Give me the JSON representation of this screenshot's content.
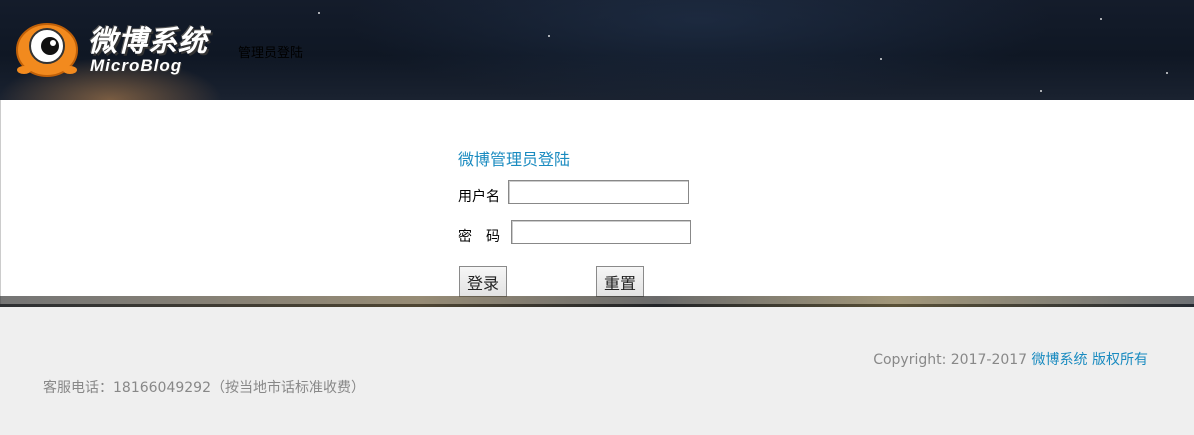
{
  "header": {
    "logo_cn": "微博系统",
    "logo_en": "MicroBlog",
    "title": "管理员登陆"
  },
  "login": {
    "heading": "微博管理员登陆",
    "username_label": "用户名",
    "password_label": "密　码",
    "username_value": "",
    "password_value": "",
    "login_button": "登录",
    "reset_button": "重置"
  },
  "footer": {
    "copyright_prefix": "Copyright: 2017-2017 ",
    "copyright_link": "微博系统 版权所有",
    "hotline": "客服电话：18166049292（按当地市话标准收费）"
  },
  "colors": {
    "link": "#1a8bc0",
    "footer_bg": "#efefef",
    "header_bg": "#0f1724"
  },
  "icons": {
    "logo": "orange-eyeball-mascot"
  }
}
